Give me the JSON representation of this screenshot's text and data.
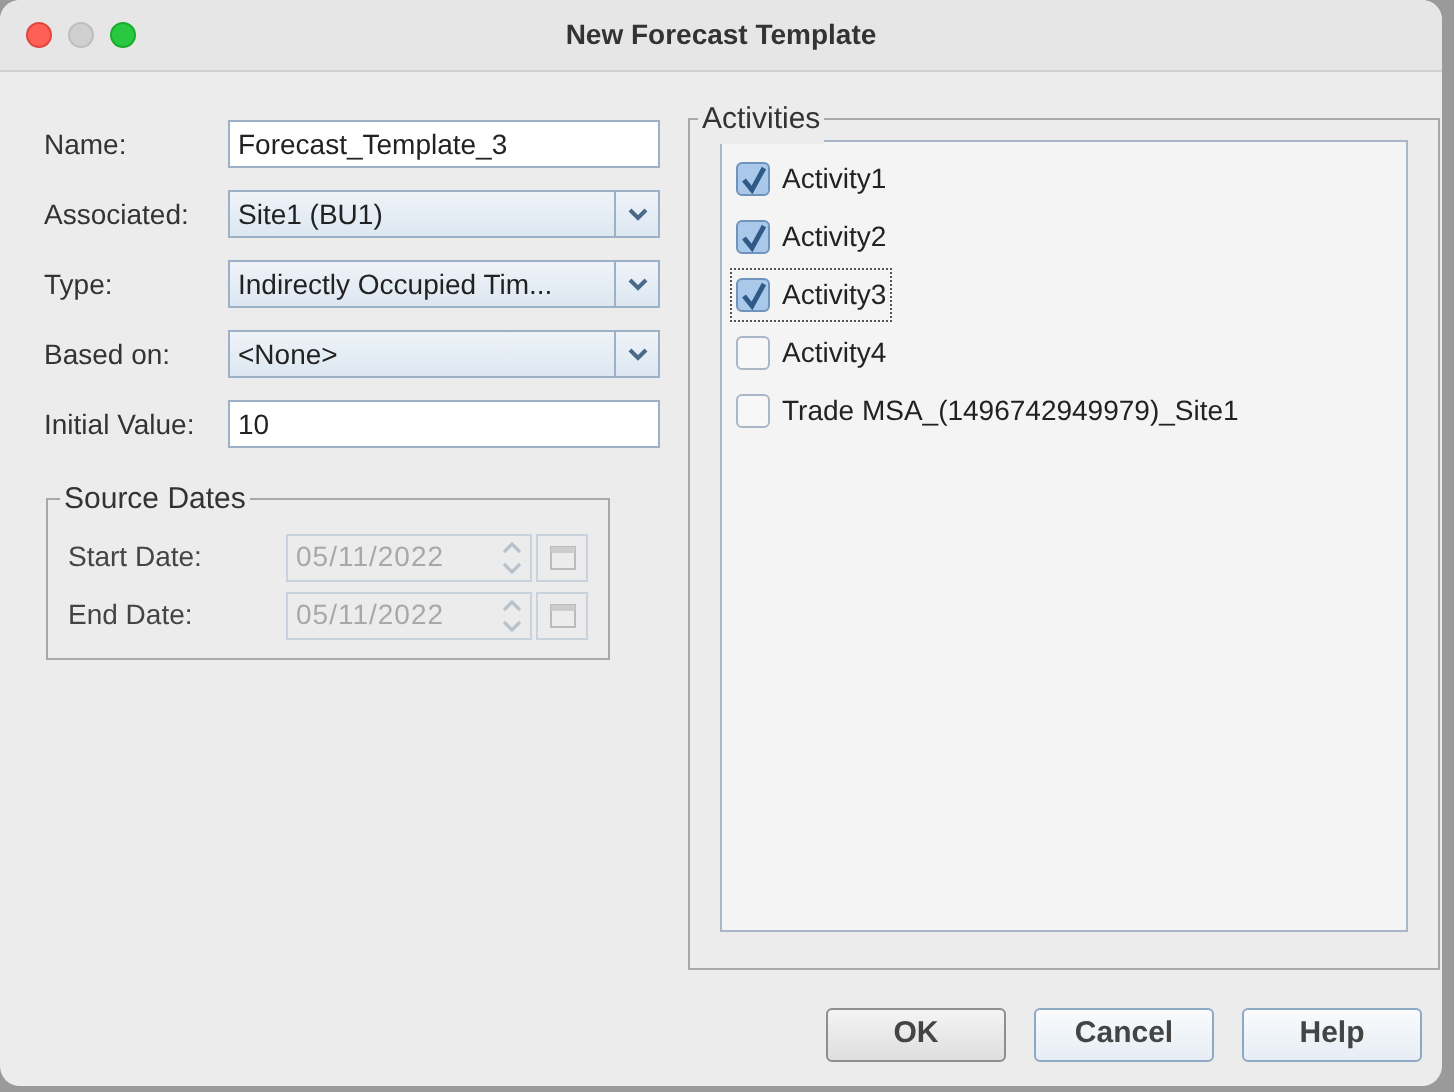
{
  "window": {
    "title": "New Forecast Template"
  },
  "fields": [
    {
      "label": "Name:",
      "kind": "text",
      "value": "Forecast_Template_3"
    },
    {
      "label": "Associated:",
      "kind": "combo",
      "value": "Site1 (BU1)"
    },
    {
      "label": "Type:",
      "kind": "combo",
      "value": "Indirectly Occupied Tim..."
    },
    {
      "label": "Based on:",
      "kind": "combo",
      "value": "<None>"
    },
    {
      "label": "Initial Value:",
      "kind": "text",
      "value": "10"
    }
  ],
  "source_dates": {
    "title": "Source Dates",
    "rows": [
      {
        "label": "Start Date:",
        "value": "05/11/2022",
        "disabled": true
      },
      {
        "label": "End Date:",
        "value": "05/11/2022",
        "disabled": true
      }
    ]
  },
  "activities": {
    "title": "Activities",
    "items": [
      {
        "label": "Activity1",
        "checked": true,
        "focused": false
      },
      {
        "label": "Activity2",
        "checked": true,
        "focused": false
      },
      {
        "label": "Activity3",
        "checked": true,
        "focused": true
      },
      {
        "label": "Activity4",
        "checked": false,
        "focused": false
      },
      {
        "label": "Trade MSA_(1496742949979)_Site1",
        "checked": false,
        "focused": false
      }
    ]
  },
  "buttons": [
    {
      "label": "OK",
      "kind": "default"
    },
    {
      "label": "Cancel",
      "kind": "normal"
    },
    {
      "label": "Help",
      "kind": "normal"
    }
  ]
}
